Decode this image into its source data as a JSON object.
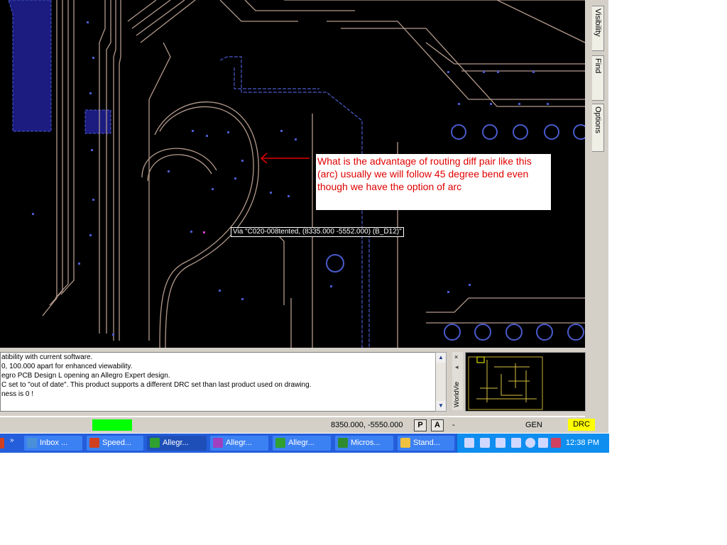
{
  "annotation": {
    "text": "What is the advantage of routing diff pair like this (arc) usually we will follow 45 degree  bend even though we have the option of arc",
    "color": "#e00000"
  },
  "tooltip": {
    "text": "Via \"C020-008tented, (8335.000 -5552.000) (B_D12)\""
  },
  "side_tabs": [
    "Visibility",
    "Find",
    "Options"
  ],
  "console": {
    "lines": [
      "atibility with current software.",
      "0, 100.000 apart for enhanced viewability.",
      "egro PCB Design L opening an Allegro Expert design.",
      "C set to \"out of date\". This product supports a different DRC set than last product used on drawing.",
      "ness is 0 !"
    ]
  },
  "worldview": {
    "label": "WorldVie",
    "close": "×",
    "arrow": "◂"
  },
  "status": {
    "coordinates": "8350.000, -5550.000",
    "p_label": "P",
    "a_label": "A",
    "dash": "-",
    "mode": "GEN",
    "drc": "DRC"
  },
  "taskbar": {
    "items": [
      {
        "label": "Inbox ...",
        "icon_color": "#4a90d9"
      },
      {
        "label": "Speed...",
        "icon_color": "#d04020"
      },
      {
        "label": "Allegr...",
        "icon_color": "#30a030"
      },
      {
        "label": "Allegr...",
        "icon_color": "#a040c0"
      },
      {
        "label": "Allegr...",
        "icon_color": "#30a030"
      },
      {
        "label": "Micros...",
        "icon_color": "#2e8b2e"
      },
      {
        "label": "Stand...",
        "icon_color": "#f0c040"
      }
    ],
    "clock": "12:38 PM"
  },
  "colors": {
    "trace": "#b49a8c",
    "shape": "#1c1c80",
    "pad": "#4a5acc",
    "drc": "#ffff00",
    "green": "#00ff00"
  }
}
